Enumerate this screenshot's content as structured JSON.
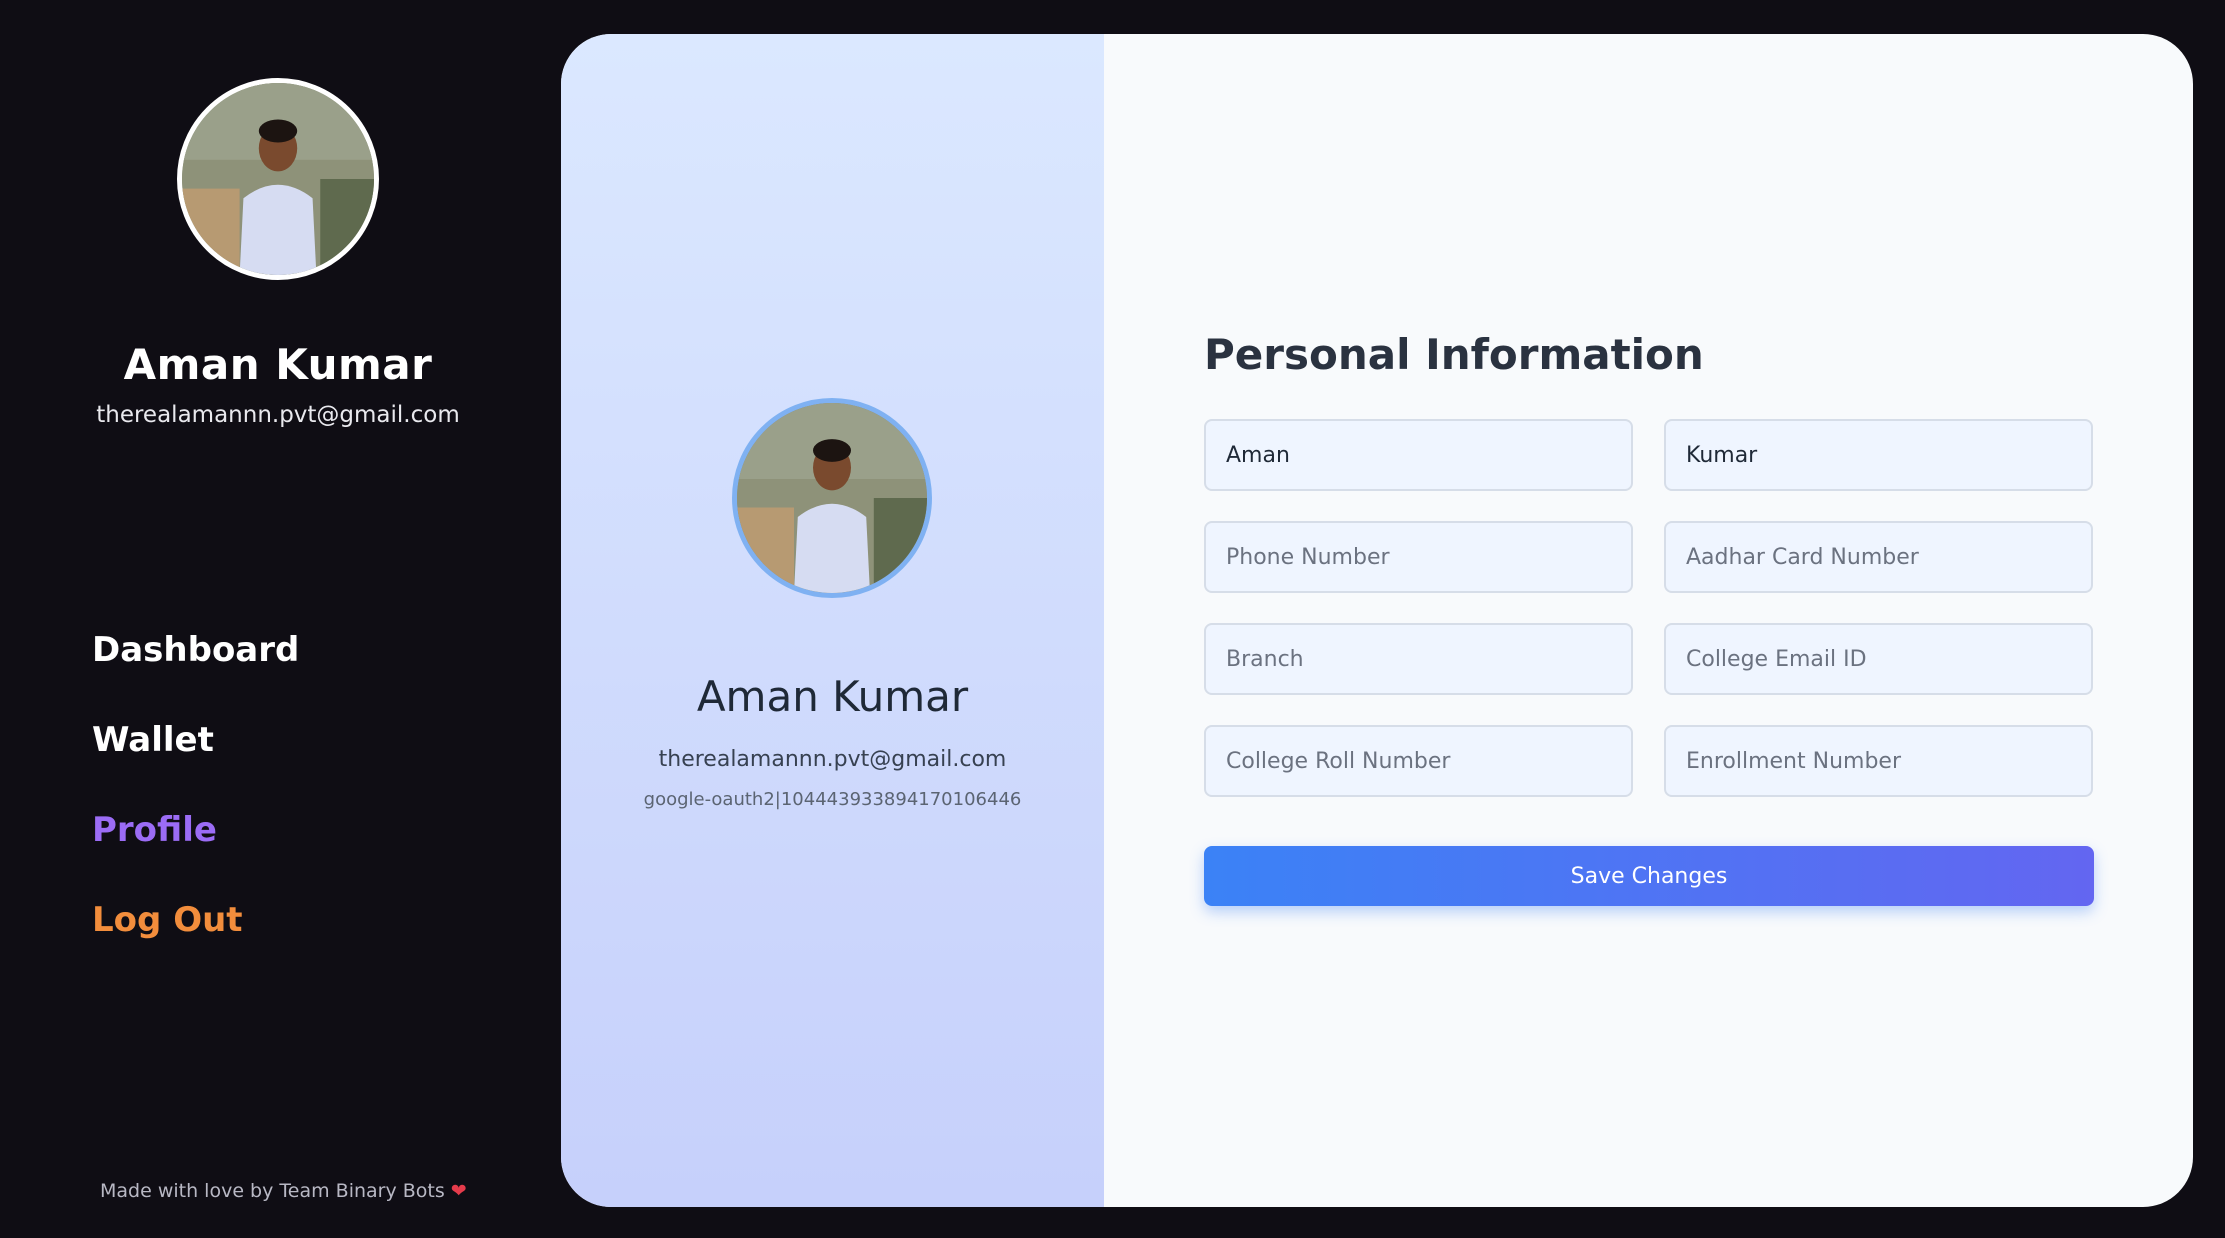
{
  "sidebar": {
    "user_name": "Aman Kumar",
    "user_email": "therealamannn.pvt@gmail.com",
    "nav": [
      {
        "label": "Dashboard"
      },
      {
        "label": "Wallet"
      },
      {
        "label": "Profile"
      },
      {
        "label": "Log Out"
      }
    ],
    "active_item": "Profile",
    "footer": "Made with love by Team Binary Bots",
    "footer_icon": "heart-icon"
  },
  "profile_card": {
    "name": "Aman Kumar",
    "email": "therealamannn.pvt@gmail.com",
    "oauth_id": "google-oauth2|104443933894170106446"
  },
  "form": {
    "title": "Personal Information",
    "first_name": {
      "value": "Aman"
    },
    "last_name": {
      "value": "Kumar"
    },
    "phone": {
      "placeholder": "Phone Number"
    },
    "aadhar": {
      "placeholder": "Aadhar Card Number"
    },
    "branch": {
      "placeholder": "Branch"
    },
    "college_email": {
      "placeholder": "College Email ID"
    },
    "roll_number": {
      "placeholder": "College Roll Number"
    },
    "enrollment": {
      "placeholder": "Enrollment Number"
    },
    "save_label": "Save Changes"
  },
  "colors": {
    "background": "#0f0d14",
    "active_nav": "#9b6cf5",
    "logout_nav": "#f28d3c",
    "button_gradient_start": "#3b82f6",
    "button_gradient_end": "#6366f1"
  }
}
